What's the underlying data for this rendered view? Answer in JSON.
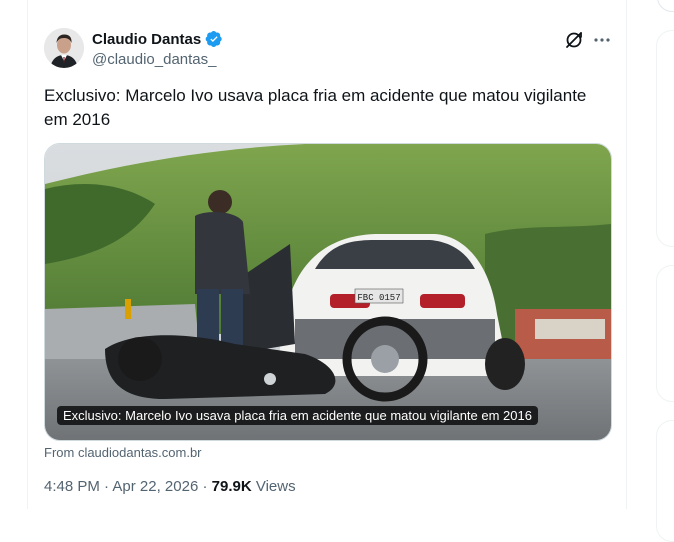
{
  "author": {
    "name": "Claudio Dantas",
    "handle": "@claudio_dantas_",
    "verified": true
  },
  "tweet": {
    "text": "Exclusivo: Marcelo Ivo usava placa fria em acidente que matou vigilante em 2016"
  },
  "media": {
    "caption": "Exclusivo: Marcelo Ivo usava placa fria em acidente que matou vigilante em 2016",
    "plate": "FBC 0157"
  },
  "link_source": "From claudiodantas.com.br",
  "meta": {
    "time": "4:48 PM",
    "date": "Apr 22, 2026",
    "separator": "·",
    "views_count": "79.9K",
    "views_label": "Views"
  },
  "icons": {
    "verified": "verified-badge-icon",
    "grok": "grok-icon",
    "more": "more-options-icon"
  },
  "colors": {
    "verified_blue": "#1d9bf0",
    "secondary_text": "#536471",
    "primary_text": "#0f1419"
  }
}
